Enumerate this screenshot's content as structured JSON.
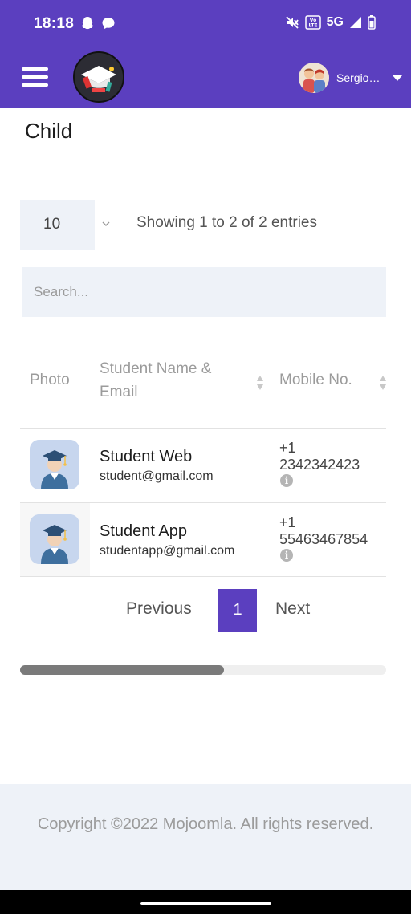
{
  "status_bar": {
    "time": "18:18",
    "left_icons": [
      "snapchat-icon",
      "chat-bubble-icon"
    ],
    "network": "5G",
    "right_icons": [
      "mute-icon",
      "volte-icon",
      "signal-icon",
      "battery-icon"
    ],
    "volte_label": "Vo LTE"
  },
  "header": {
    "menu_icon": "hamburger-menu-icon",
    "logo": "school-logo",
    "user_name": "Sergio…",
    "caret_icon": "caret-down-icon",
    "accent_color": "#5b3fbf"
  },
  "page": {
    "title": "Child"
  },
  "table_controls": {
    "page_length": "10",
    "entries_info": "Showing 1 to 2 of 2 entries",
    "search_placeholder": "Search..."
  },
  "table": {
    "headers": {
      "photo": "Photo",
      "name_line1": "Student Name &",
      "name_line2": "Email",
      "mobile": "Mobile No."
    },
    "rows": [
      {
        "name": "Student Web",
        "email": "student@gmail.com",
        "country_code": "+1",
        "mobile": "2342342423"
      },
      {
        "name": "Student App",
        "email": "studentapp@gmail.com",
        "country_code": "+1",
        "mobile": "55463467854"
      }
    ]
  },
  "pagination": {
    "previous": "Previous",
    "current": "1",
    "next": "Next"
  },
  "footer": {
    "copyright": "Copyright ©2022 Mojoomla. All rights reserved."
  }
}
